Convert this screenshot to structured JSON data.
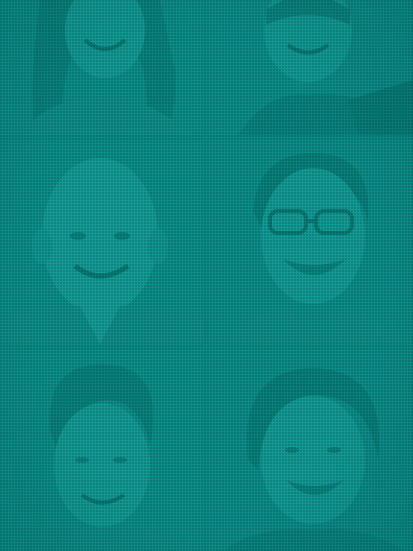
{
  "colors": {
    "teal_base": "#0b8a86",
    "teal_light": "#19a39e",
    "teal_dark": "#067470"
  },
  "portraits": [
    {
      "id": "portrait-1"
    },
    {
      "id": "portrait-2"
    },
    {
      "id": "portrait-3"
    },
    {
      "id": "portrait-4"
    },
    {
      "id": "portrait-5"
    },
    {
      "id": "portrait-6"
    }
  ]
}
